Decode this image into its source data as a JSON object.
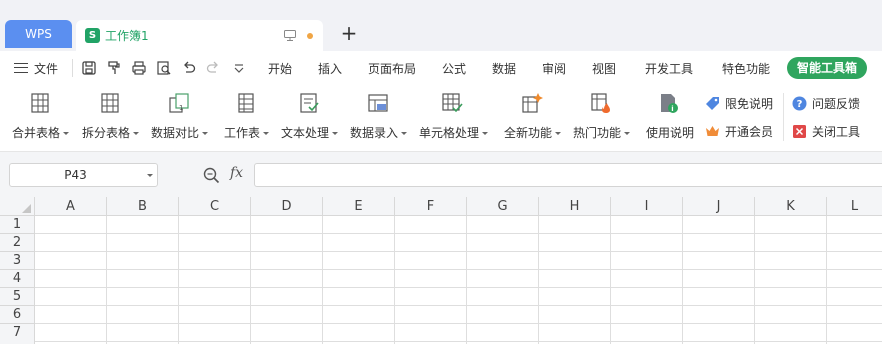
{
  "tabs": {
    "wps_label": "WPS",
    "doc_icon": "S",
    "doc_name": "工作簿1",
    "new_tab": "+"
  },
  "menubar": {
    "file_label": "文件",
    "quick_icons": [
      "save-icon",
      "format-painter-icon",
      "print-icon",
      "print-preview-icon",
      "undo-icon",
      "redo-icon",
      "customize-dropdown-icon"
    ],
    "items": [
      "开始",
      "插入",
      "页面布局",
      "公式",
      "数据",
      "审阅",
      "视图",
      "开发工具",
      "特色功能"
    ],
    "smart_toolbox": "智能工具箱"
  },
  "ribbon": {
    "buttons": [
      {
        "label": "合并表格",
        "icon": "merge-table-icon",
        "dropdown": true
      },
      {
        "label": "拆分表格",
        "icon": "split-table-icon",
        "dropdown": true
      },
      {
        "label": "数据对比",
        "icon": "data-compare-icon",
        "dropdown": true
      },
      {
        "label": "工作表",
        "icon": "worksheet-icon",
        "dropdown": true
      },
      {
        "label": "文本处理",
        "icon": "text-process-icon",
        "dropdown": true
      },
      {
        "label": "数据录入",
        "icon": "data-entry-icon",
        "dropdown": true
      },
      {
        "label": "单元格处理",
        "icon": "cell-process-icon",
        "dropdown": true
      },
      {
        "label": "全新功能",
        "icon": "new-feature-icon",
        "dropdown": true
      },
      {
        "label": "热门功能",
        "icon": "hot-feature-icon",
        "dropdown": true
      },
      {
        "label": "使用说明",
        "icon": "help-doc-icon",
        "dropdown": false
      }
    ],
    "side": {
      "free_limit": "限免说明",
      "vip": "开通会员",
      "feedback": "问题反馈",
      "close_tool": "关闭工具"
    }
  },
  "formula_bar": {
    "name_box": "P43",
    "fx": "fx",
    "formula": ""
  },
  "grid": {
    "columns": [
      "A",
      "B",
      "C",
      "D",
      "E",
      "F",
      "G",
      "H",
      "I",
      "J",
      "K",
      "L"
    ],
    "rows": [
      "1",
      "2",
      "3",
      "4",
      "5",
      "6",
      "7"
    ]
  },
  "colors": {
    "wps_tab": "#5b8ff0",
    "accent_green": "#21a366",
    "smart_button": "#2fa55e"
  }
}
